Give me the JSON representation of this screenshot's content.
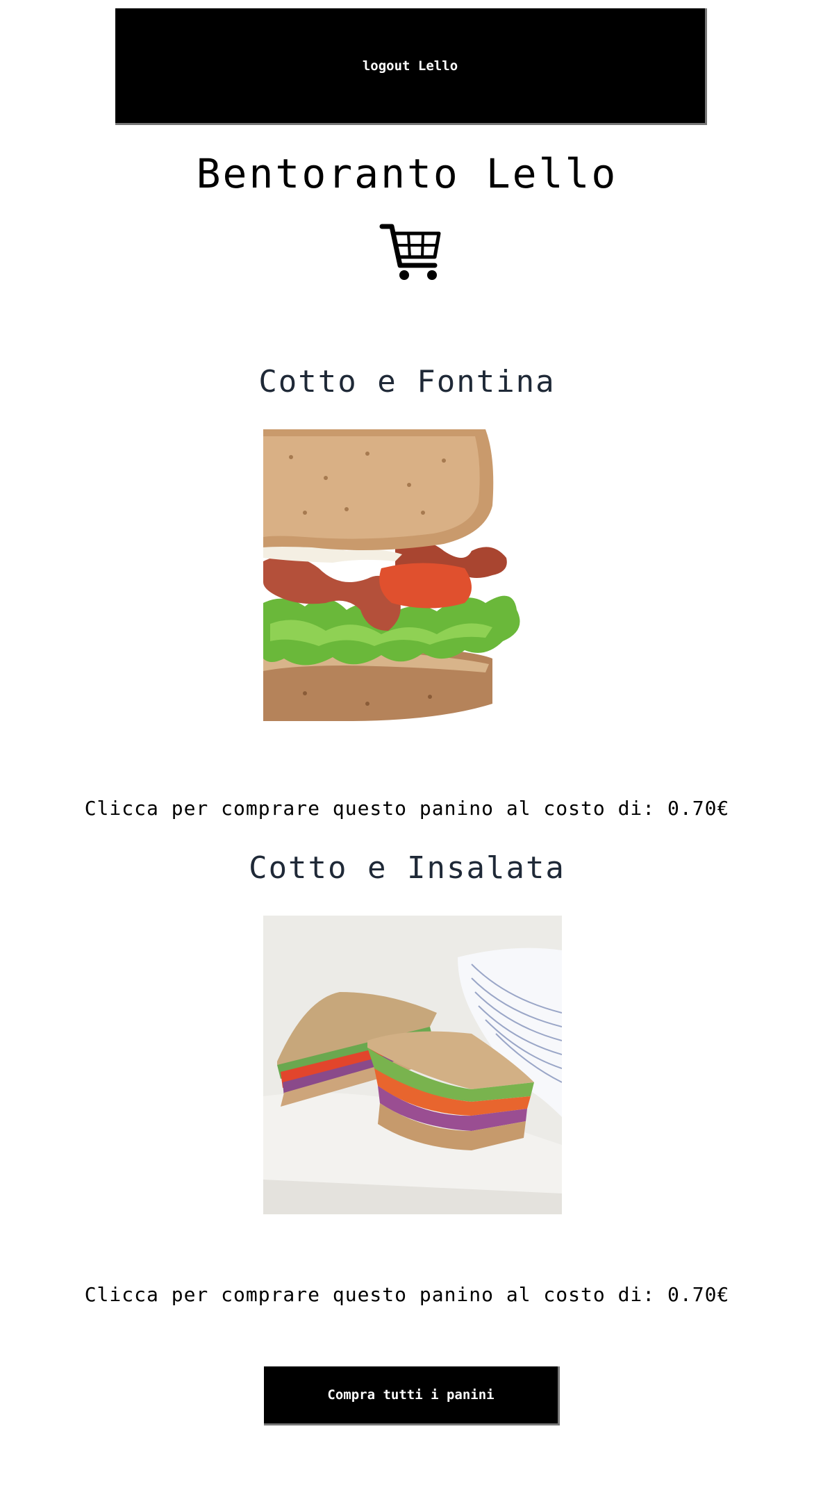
{
  "header": {
    "logout_label": "logout Lello"
  },
  "site": {
    "title": "Bentoranto Lello",
    "cart_icon": "shopping-cart-icon"
  },
  "products": [
    {
      "name": "Cotto e Fontina",
      "image": "blt-sandwich-photo",
      "buy_text": "Clicca per comprare questo panino al costo di: 0.70€"
    },
    {
      "name": "Cotto e Insalata",
      "image": "veggie-sandwich-photo",
      "buy_text": "Clicca per comprare questo panino al costo di: 0.70€"
    }
  ],
  "footer": {
    "buy_all_label": "Compra tutti i panini"
  },
  "colors": {
    "button_bg": "#000000",
    "button_text": "#ffffff",
    "product_title": "#1f2937"
  }
}
